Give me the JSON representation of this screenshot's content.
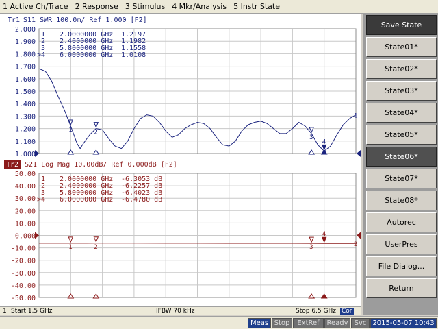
{
  "menubar": [
    "1 Active Ch/Trace",
    "2 Response",
    "3 Stimulus",
    "4 Mkr/Analysis",
    "5 Instr State"
  ],
  "trace1": {
    "id": "Tr1",
    "header_text": "S11  SWR 100.0m/ Ref 1.000  [F2]",
    "color": "#1a237e",
    "y_labels": [
      "2.000",
      "1.900",
      "1.800",
      "1.700",
      "1.600",
      "1.500",
      "1.400",
      "1.300",
      "1.200",
      "1.100",
      "1.000"
    ],
    "ref_label": "1.000",
    "markers": [
      {
        "num": "1",
        "freq": "2.0000000 GHz",
        "value": "1.2197"
      },
      {
        "num": "2",
        "freq": "2.4000000 GHz",
        "value": "1.1982"
      },
      {
        "num": "3",
        "freq": "5.8000000 GHz",
        "value": "1.1558"
      },
      {
        "num": ">4",
        "freq": "6.0000000 GHz",
        "value": "1.0108"
      }
    ],
    "trace_marker": "1"
  },
  "trace2": {
    "id": "Tr2",
    "header_text": "S21  Log Mag 10.00dB/ Ref 0.000dB  [F2]",
    "color": "#8b1a1a",
    "y_labels": [
      "50.00",
      "40.00",
      "30.00",
      "20.00",
      "10.00",
      "0.000",
      "-10.00",
      "-20.00",
      "-30.00",
      "-40.00",
      "-50.00"
    ],
    "ref_label": "0.000",
    "markers": [
      {
        "num": "1",
        "freq": "2.0000000 GHz",
        "value": "-6.3053 dB"
      },
      {
        "num": "2",
        "freq": "2.4000000 GHz",
        "value": "-6.2257 dB"
      },
      {
        "num": "3",
        "freq": "5.8000000 GHz",
        "value": "-6.4023 dB"
      },
      {
        "num": ">4",
        "freq": "6.0000000 GHz",
        "value": "-6.4780 dB"
      }
    ],
    "trace_marker": "2"
  },
  "markers_on_trace": [
    "1",
    "2",
    "3",
    "4"
  ],
  "chart_data": [
    {
      "type": "line",
      "title": "Tr1 S11 SWR 100.0m/ Ref 1.000 [F2]",
      "xlabel": "",
      "ylabel": "",
      "xlim": [
        1.5,
        6.5
      ],
      "ylim": [
        1.0,
        2.0
      ],
      "grid": true,
      "x": [
        1.5,
        1.6,
        1.7,
        1.8,
        1.9,
        2.0,
        2.1,
        2.15,
        2.2,
        2.3,
        2.4,
        2.5,
        2.6,
        2.7,
        2.8,
        2.9,
        3.0,
        3.1,
        3.2,
        3.3,
        3.4,
        3.5,
        3.6,
        3.7,
        3.8,
        3.9,
        4.0,
        4.1,
        4.2,
        4.3,
        4.4,
        4.5,
        4.6,
        4.7,
        4.8,
        4.9,
        5.0,
        5.1,
        5.2,
        5.3,
        5.4,
        5.5,
        5.6,
        5.7,
        5.8,
        5.9,
        6.0,
        6.1,
        6.2,
        6.3,
        6.4,
        6.5
      ],
      "series": [
        {
          "values": [
            1.68,
            1.66,
            1.58,
            1.46,
            1.35,
            1.22,
            1.08,
            1.04,
            1.08,
            1.15,
            1.2,
            1.19,
            1.12,
            1.06,
            1.04,
            1.1,
            1.2,
            1.28,
            1.31,
            1.3,
            1.25,
            1.18,
            1.13,
            1.15,
            1.2,
            1.23,
            1.25,
            1.24,
            1.2,
            1.13,
            1.07,
            1.06,
            1.1,
            1.18,
            1.23,
            1.25,
            1.26,
            1.24,
            1.2,
            1.16,
            1.16,
            1.2,
            1.25,
            1.22,
            1.16,
            1.07,
            1.02,
            1.06,
            1.15,
            1.23,
            1.28,
            1.31
          ]
        }
      ]
    },
    {
      "type": "line",
      "title": "Tr2 S21 Log Mag 10.00dB/ Ref 0.000dB [F2]",
      "xlabel": "",
      "ylabel": "",
      "xlim": [
        1.5,
        6.5
      ],
      "ylim": [
        -50,
        50
      ],
      "grid": true,
      "x": [
        1.5,
        2.0,
        2.4,
        3.0,
        3.5,
        4.0,
        4.5,
        5.0,
        5.5,
        5.8,
        6.0,
        6.5
      ],
      "series": [
        {
          "values": [
            -6.3,
            -6.3053,
            -6.2257,
            -6.25,
            -6.3,
            -6.28,
            -6.33,
            -6.35,
            -6.38,
            -6.4023,
            -6.478,
            -6.45
          ]
        }
      ]
    }
  ],
  "status": {
    "channel": "1",
    "start": "Start 1.5 GHz",
    "ifbw": "IFBW 70 kHz",
    "stop": "Stop 6.5 GHz",
    "cor": "Cor"
  },
  "softkeys": {
    "header": "Save State",
    "items": [
      "State01*",
      "State02*",
      "State03*",
      "State04*",
      "State05*",
      "State06*",
      "State07*",
      "State08*",
      "Autorec",
      "UserPres",
      "File Dialog...",
      "Return"
    ],
    "active_index": 5
  },
  "bottom": {
    "meas": "Meas",
    "stop": "Stop",
    "extref": "ExtRef",
    "ready": "Ready",
    "svc": "Svc",
    "datetime": "2015-05-07 10:43"
  }
}
